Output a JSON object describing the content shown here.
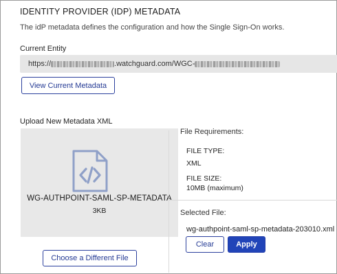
{
  "section": {
    "title": "IDENTITY PROVIDER (IDP) METADATA",
    "description": "The idP metadata defines the configuration and how the Single Sign-On works."
  },
  "current_entity": {
    "label": "Current Entity",
    "url_prefix": "https://",
    "url_middle": ".watchguard.com/WGC-"
  },
  "buttons": {
    "view_metadata": "View Current Metadata",
    "choose_file": "Choose a Different File",
    "clear": "Clear",
    "apply": "Apply"
  },
  "upload": {
    "label": "Upload New Metadata XML",
    "file_name": "WG-AUTHPOINT-SAML-SP-METADATA",
    "file_size": "3KB",
    "file_icon": "xml-file-icon"
  },
  "requirements": {
    "label": "File Requirements:",
    "file_type_label": "FILE TYPE:",
    "file_type_value": "XML",
    "file_size_label": "FILE SIZE:",
    "file_size_value": "10MB (maximum)"
  },
  "selected": {
    "label": "Selected File:",
    "value": "wg-authpoint-saml-sp-metadata-203010.xml"
  },
  "colors": {
    "accent": "#2144b8",
    "dropzone": "#e8e8e8",
    "field": "#e6e6e6"
  }
}
